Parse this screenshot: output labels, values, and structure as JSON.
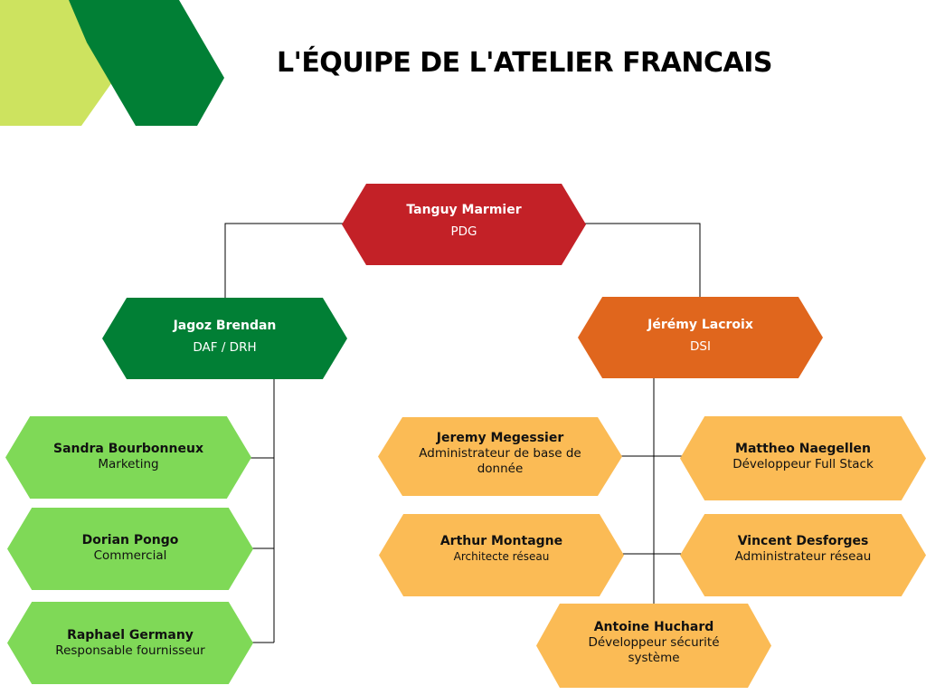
{
  "title": "L'ÉQUIPE DE L'ATELIER FRANCAIS",
  "colors": {
    "red": "#c32127",
    "dark_green": "#017f35",
    "orange": "#e0661d",
    "light_green": "#7fd957",
    "yellow": "#fbbb55",
    "lime": "#cde35f",
    "line": "#000000"
  },
  "org": {
    "ceo": {
      "name": "Tanguy Marmier",
      "role": "PDG"
    },
    "finance_hr": {
      "name": "Jagoz Brendan",
      "role": "DAF / DRH"
    },
    "it": {
      "name": "Jérémy Lacroix",
      "role": "DSI"
    },
    "finance_team": [
      {
        "name": "Sandra Bourbonneux",
        "role": "Marketing"
      },
      {
        "name": "Dorian Pongo",
        "role": "Commercial"
      },
      {
        "name": "Raphael Germany",
        "role": "Responsable fournisseur"
      }
    ],
    "it_team": [
      {
        "name": "Jeremy Megessier",
        "role": "Administrateur de base de donnée"
      },
      {
        "name": "Mattheo Naegellen",
        "role": "Développeur Full Stack"
      },
      {
        "name": "Arthur Montagne",
        "role": "Architecte réseau"
      },
      {
        "name": "Vincent Desforges",
        "role": "Administrateur réseau"
      },
      {
        "name": "Antoine Huchard",
        "role": "Développeur sécurité système"
      }
    ]
  }
}
